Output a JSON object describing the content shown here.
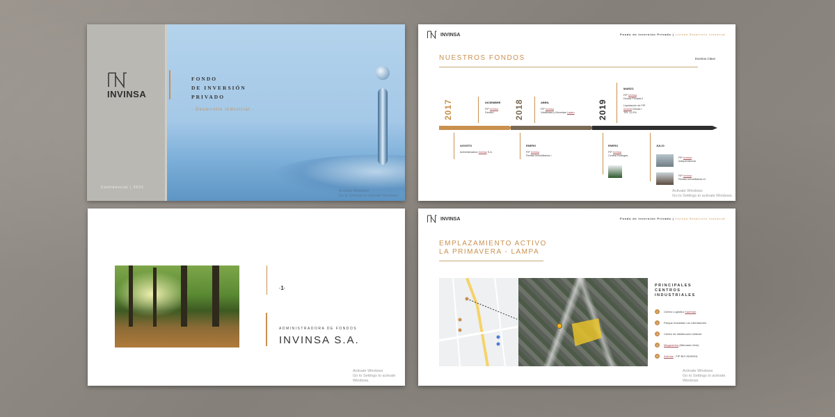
{
  "slide1": {
    "brand": "INVINSA",
    "title_lines": [
      "FONDO",
      "DE INVERSIÓN",
      "PRIVADO"
    ],
    "subtitle": "- Desarrollo Industrial -",
    "confidential": "Confidencial | 2023",
    "watermark_1": "Activate Windows",
    "watermark_2": "Go to Settings to activate Windows"
  },
  "header": {
    "brand": "INVINSA",
    "fund": "Fondo de Inversión Privado",
    "separator": "|",
    "accent": "Invinsa",
    "accent_suffix": "Desarrollo Industrial"
  },
  "slide2": {
    "title": "NUESTROS FONDOS",
    "eventos": "Eventos Clave",
    "years": [
      "2017",
      "2018",
      "2019"
    ],
    "year_colors": [
      "#c9904e",
      "#7a6a55",
      "#2f2f2f"
    ],
    "top_events": [
      {
        "month": "DICIEMBRE",
        "lines": [
          "FIP",
          "Invinsa",
          "Deuda I"
        ]
      },
      {
        "month": "ABRIL",
        "lines": [
          "FIP",
          "Invinsa",
          "Volatilidad y Monedas",
          "Latam"
        ]
      },
      {
        "month": "MARZO",
        "lines": [
          "FIP",
          "Invinsa",
          "Deuda Privada II",
          "Liquidación de FIP",
          "Invinsa",
          "Deuda I",
          "TIR: 11,9%"
        ]
      }
    ],
    "bottom_events": [
      {
        "month": "AGOSTO",
        "lines": [
          "Administradora",
          "Invinsa",
          "S.A."
        ]
      },
      {
        "month": "ENERO",
        "lines": [
          "FIP",
          "Invinsa",
          "Rentas Inmobiliarias I"
        ]
      },
      {
        "month": "ENERO",
        "lines": [
          "FIP",
          "Invinsa",
          "Central Bodegas"
        ]
      },
      {
        "month": "JULIO",
        "lines": [
          "FIP",
          "Invinsa",
          "Independencia",
          "FIP",
          "Invinsa",
          "Rentas Inmobiliarias III"
        ]
      }
    ],
    "watermark_1": "Activate Windows",
    "watermark_2": "Go to Settings to activate Windows."
  },
  "slide3": {
    "number": "1",
    "kicker": "ADMINISTRADORA DE FONDOS",
    "name": "INVINSA S.A.",
    "watermark_1": "Activate Windows",
    "watermark_2": "Go to Settings to activate Windows."
  },
  "slide4": {
    "title_lines": [
      "EMPLAZAMIENTO ACTIVO",
      "LA PRIMAVERA - LAMPA"
    ],
    "principales_lines": [
      "PRINCIPALES",
      "CENTROS",
      "INDUSTRIALES"
    ],
    "items": [
      {
        "n": "1",
        "pre": "Centro Logístico ",
        "link": "Kaufman",
        "post": ""
      },
      {
        "n": "2",
        "pre": "Parque Industrial Los Libertadores",
        "link": "",
        "post": ""
      },
      {
        "n": "3",
        "pre": "Centro de distribución Unilever",
        "link": "",
        "post": ""
      },
      {
        "n": "4",
        "pre": "",
        "link": "Megacentro",
        "post": " (Mercado Libre)"
      },
      {
        "n": "5",
        "pre": "",
        "link": "Arrimas",
        "post": " - FIP BCI INVINSA"
      }
    ],
    "watermark_1": "Activate Windows",
    "watermark_2": "Go to Settings to activate Windows."
  },
  "colors": {
    "accent": "#c9904e",
    "link": "#a0484c",
    "panel": "#b9b8b3"
  }
}
